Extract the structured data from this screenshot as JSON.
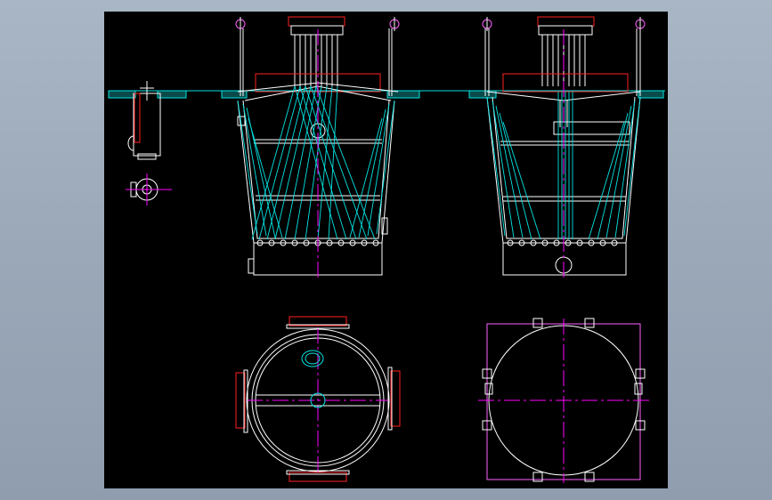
{
  "drawing": {
    "background": "#000000",
    "frame_color": "#a9b6c5",
    "colors": {
      "outline": "#ffffff",
      "hidden": "#00e5e5",
      "center_line": "#ff00ff",
      "section": "#ff2020",
      "nozzle": "#ff60ff"
    }
  },
  "views": [
    {
      "name": "front-elevation"
    },
    {
      "name": "side-elevation"
    },
    {
      "name": "top-plan"
    },
    {
      "name": "bottom-plan"
    },
    {
      "name": "nozzle-detail"
    }
  ]
}
